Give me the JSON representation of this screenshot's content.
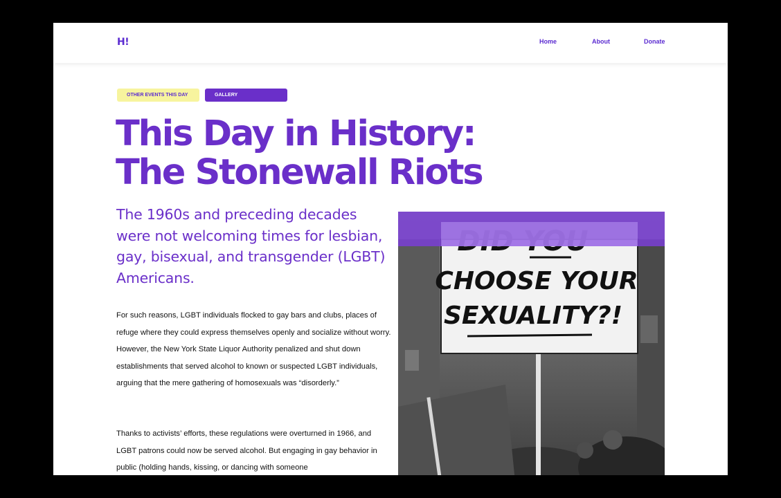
{
  "nav": {
    "logo": "H!",
    "home": "Home",
    "about": "About",
    "donate": "Donate"
  },
  "tags": {
    "other_events": "OTHER EVENTS THIS DAY",
    "gallery": "GALLERY"
  },
  "article": {
    "title_line1": "This Day in History:",
    "title_line2": "The Stonewall Riots",
    "lead": "The 1960s and preceding decades were not welcoming times for lesbian, gay, bisexual, and transgender (LGBT) Americans.",
    "para1": "For such reasons, LGBT individuals flocked to gay bars and clubs, places of refuge where they could express themselves openly and socialize without worry. However, the New York State Liquor Authority penalized and shut down establishments that served alcohol to known or suspected LGBT individuals, arguing that the mere gathering of homosexuals was “disorderly.”",
    "para2": "Thanks to activists’ efforts, these regulations were overturned in 1966, and LGBT patrons could now be served alcohol. But engaging in gay behavior in public (holding hands, kissing, or dancing with someone"
  },
  "photo": {
    "sign_line1": "DID YOU",
    "sign_line2": "CHOOSE YOUR",
    "sign_line3": "SEXUALITY?!"
  },
  "colors": {
    "brand_purple": "#6a2fc9",
    "tag_yellow": "#f7f49e"
  }
}
